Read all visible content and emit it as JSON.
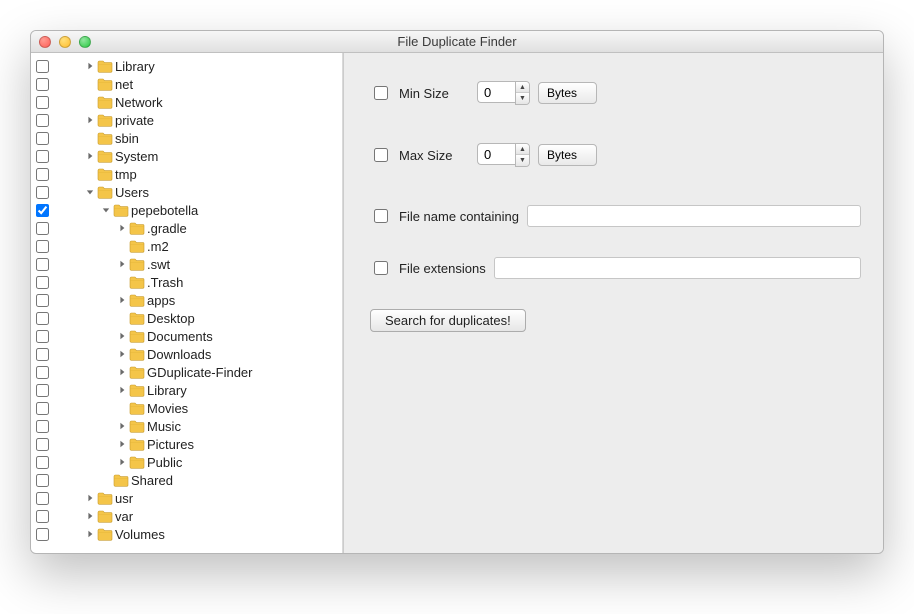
{
  "window": {
    "title": "File Duplicate Finder"
  },
  "tree": [
    {
      "label": "Library",
      "depth": 2,
      "expandable": true,
      "expanded": false,
      "checked": false
    },
    {
      "label": "net",
      "depth": 2,
      "expandable": false,
      "expanded": false,
      "checked": false
    },
    {
      "label": "Network",
      "depth": 2,
      "expandable": false,
      "expanded": false,
      "checked": false
    },
    {
      "label": "private",
      "depth": 2,
      "expandable": true,
      "expanded": false,
      "checked": false
    },
    {
      "label": "sbin",
      "depth": 2,
      "expandable": false,
      "expanded": false,
      "checked": false
    },
    {
      "label": "System",
      "depth": 2,
      "expandable": true,
      "expanded": false,
      "checked": false
    },
    {
      "label": "tmp",
      "depth": 2,
      "expandable": false,
      "expanded": false,
      "checked": false
    },
    {
      "label": "Users",
      "depth": 2,
      "expandable": true,
      "expanded": true,
      "checked": false
    },
    {
      "label": "pepebotella",
      "depth": 3,
      "expandable": true,
      "expanded": true,
      "checked": true
    },
    {
      "label": ".gradle",
      "depth": 4,
      "expandable": true,
      "expanded": false,
      "checked": false
    },
    {
      "label": ".m2",
      "depth": 4,
      "expandable": false,
      "expanded": false,
      "checked": false
    },
    {
      "label": ".swt",
      "depth": 4,
      "expandable": true,
      "expanded": false,
      "checked": false
    },
    {
      "label": ".Trash",
      "depth": 4,
      "expandable": false,
      "expanded": false,
      "checked": false
    },
    {
      "label": "apps",
      "depth": 4,
      "expandable": true,
      "expanded": false,
      "checked": false
    },
    {
      "label": "Desktop",
      "depth": 4,
      "expandable": false,
      "expanded": false,
      "checked": false
    },
    {
      "label": "Documents",
      "depth": 4,
      "expandable": true,
      "expanded": false,
      "checked": false
    },
    {
      "label": "Downloads",
      "depth": 4,
      "expandable": true,
      "expanded": false,
      "checked": false
    },
    {
      "label": "GDuplicate-Finder",
      "depth": 4,
      "expandable": true,
      "expanded": false,
      "checked": false
    },
    {
      "label": "Library",
      "depth": 4,
      "expandable": true,
      "expanded": false,
      "checked": false
    },
    {
      "label": "Movies",
      "depth": 4,
      "expandable": false,
      "expanded": false,
      "checked": false
    },
    {
      "label": "Music",
      "depth": 4,
      "expandable": true,
      "expanded": false,
      "checked": false
    },
    {
      "label": "Pictures",
      "depth": 4,
      "expandable": true,
      "expanded": false,
      "checked": false
    },
    {
      "label": "Public",
      "depth": 4,
      "expandable": true,
      "expanded": false,
      "checked": false
    },
    {
      "label": "Shared",
      "depth": 3,
      "expandable": false,
      "expanded": false,
      "checked": false
    },
    {
      "label": "usr",
      "depth": 2,
      "expandable": true,
      "expanded": false,
      "checked": false
    },
    {
      "label": "var",
      "depth": 2,
      "expandable": true,
      "expanded": false,
      "checked": false
    },
    {
      "label": "Volumes",
      "depth": 2,
      "expandable": true,
      "expanded": false,
      "checked": false
    }
  ],
  "filters": {
    "min_label": "Min Size",
    "min_value": "0",
    "max_label": "Max Size",
    "max_value": "0",
    "unit": "Bytes",
    "name_label": "File name containing",
    "name_value": "",
    "ext_label": "File extensions",
    "ext_value": "",
    "search_label": "Search for duplicates!"
  }
}
